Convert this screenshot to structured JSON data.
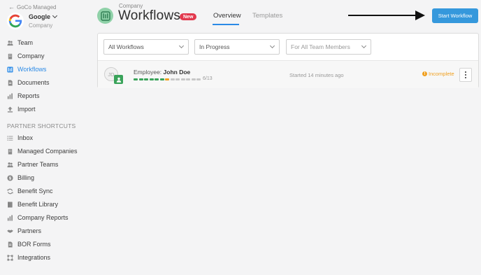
{
  "sidebar": {
    "back_label": "GoCo Managed",
    "company": {
      "name": "Google",
      "subtitle": "Company"
    },
    "items": [
      {
        "label": "Team",
        "icon": "people-icon"
      },
      {
        "label": "Company",
        "icon": "building-icon"
      },
      {
        "label": "Workflows",
        "icon": "workflow-icon",
        "active": true
      },
      {
        "label": "Documents",
        "icon": "document-icon"
      },
      {
        "label": "Reports",
        "icon": "bar-chart-icon"
      },
      {
        "label": "Import",
        "icon": "upload-icon"
      }
    ],
    "section_label": "PARTNER SHORTCUTS",
    "shortcuts": [
      {
        "label": "Inbox",
        "icon": "list-icon"
      },
      {
        "label": "Managed Companies",
        "icon": "building-icon"
      },
      {
        "label": "Partner Teams",
        "icon": "people-icon"
      },
      {
        "label": "Billing",
        "icon": "dollar-icon"
      },
      {
        "label": "Benefit Sync",
        "icon": "sync-icon"
      },
      {
        "label": "Benefit Library",
        "icon": "book-icon"
      },
      {
        "label": "Company Reports",
        "icon": "bar-chart-icon"
      },
      {
        "label": "Partners",
        "icon": "handshake-icon"
      },
      {
        "label": "BOR Forms",
        "icon": "document-icon"
      },
      {
        "label": "Integrations",
        "icon": "integration-icon"
      }
    ]
  },
  "header": {
    "breadcrumb": "Company",
    "title": "Workflows",
    "badge": "New",
    "tabs": [
      {
        "label": "Overview",
        "active": true
      },
      {
        "label": "Templates",
        "active": false
      }
    ],
    "start_button": "Start Workflow"
  },
  "filters": {
    "workflow_type": "All Workflows",
    "status": "In Progress",
    "members": "For All Team Members"
  },
  "workflow": {
    "avatar_initials": "JD",
    "employee_prefix": "Employee:",
    "employee_name": "John Doe",
    "progress_done": 6,
    "progress_total": 13,
    "progress_text": "6/13",
    "started": "Started 14 minutes ago",
    "status": "Incomplete",
    "status_icon": "!"
  },
  "colors": {
    "accent": "#2b8ae6",
    "button": "#3598dc",
    "badge": "#e2384d",
    "success": "#3aa35a",
    "warning": "#f0a020"
  }
}
